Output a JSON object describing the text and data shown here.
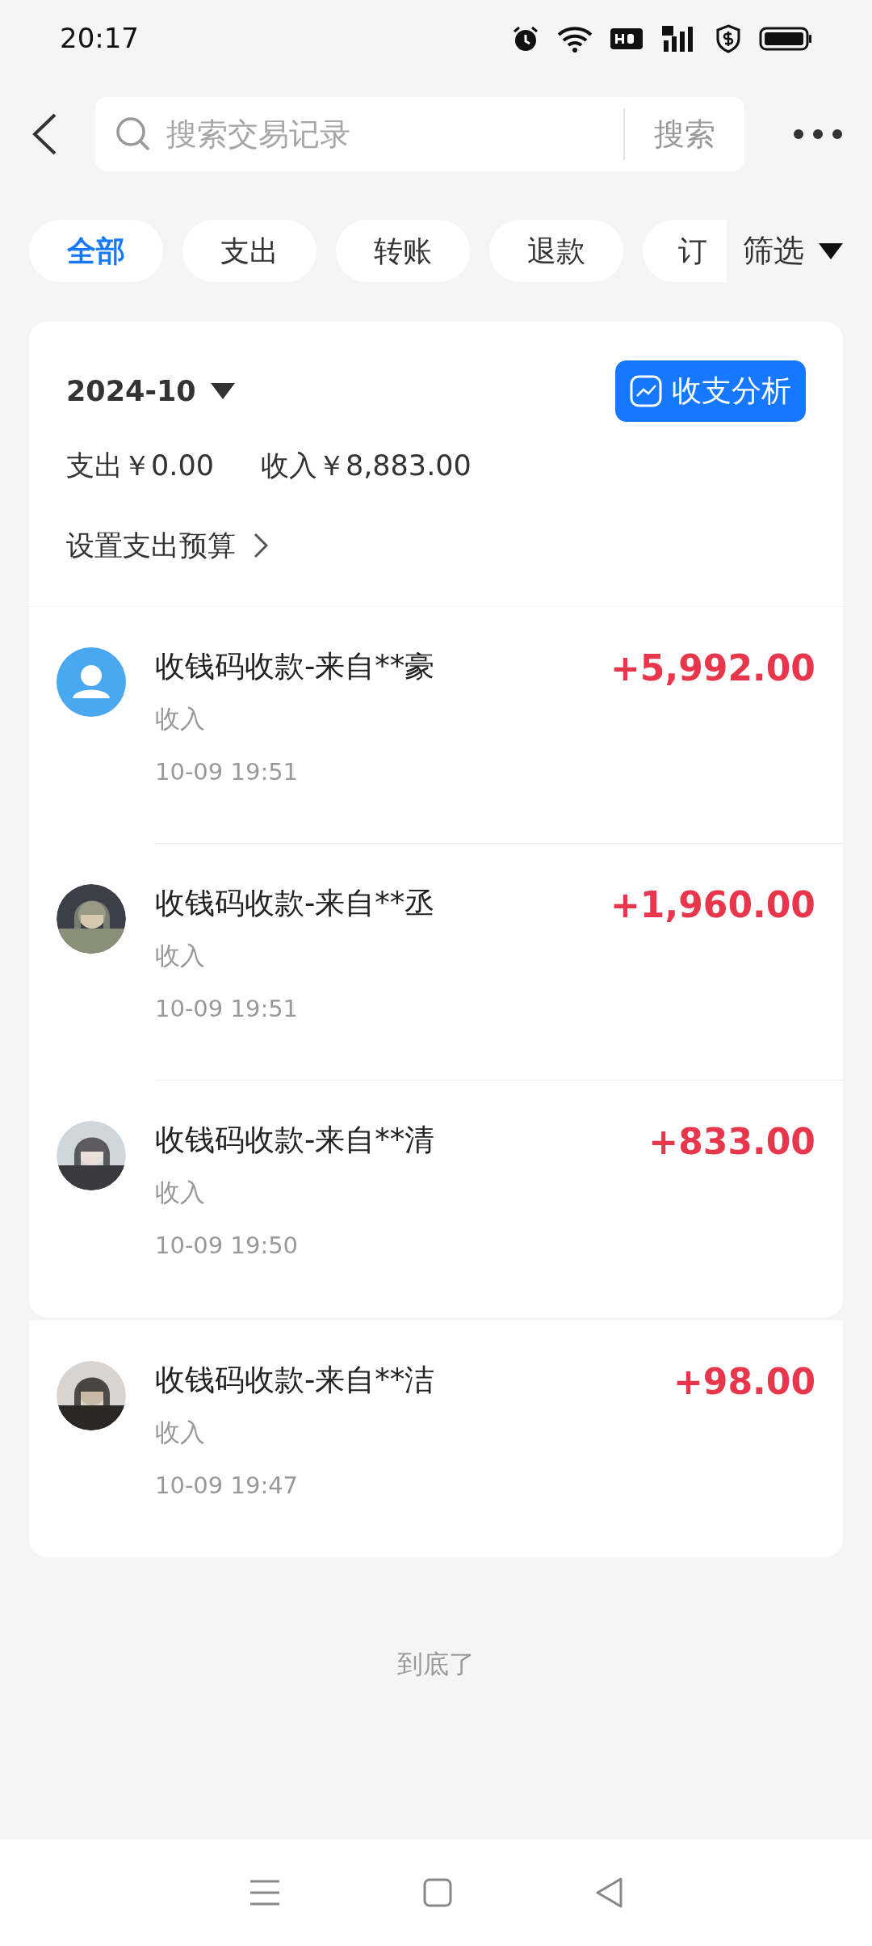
{
  "status_bar": {
    "time": "20:17"
  },
  "search": {
    "placeholder": "搜索交易记录",
    "button": "搜索"
  },
  "tabs": [
    {
      "label": "全部",
      "selected": true
    },
    {
      "label": "支出",
      "selected": false
    },
    {
      "label": "转账",
      "selected": false
    },
    {
      "label": "退款",
      "selected": false
    },
    {
      "label": "订",
      "selected": false
    }
  ],
  "filter": {
    "label": "筛选"
  },
  "summary": {
    "month": "2024-10",
    "analysis_button": "收支分析",
    "expense": "支出￥0.00",
    "income": "收入￥8,883.00",
    "budget_link": "设置支出预算"
  },
  "transactions": [
    {
      "avatar": {
        "kind": "default"
      },
      "title": "收钱码收款-来自**豪",
      "type": "收入",
      "time": "10-09 19:51",
      "amount": "+5,992.00"
    },
    {
      "title": "收钱码收款-来自**丞",
      "type": "收入",
      "time": "10-09 19:51",
      "amount": "+1,960.00"
    },
    {
      "title": "收钱码收款-来自**清",
      "type": "收入",
      "time": "10-09 19:50",
      "amount": "+833.00"
    },
    {
      "title": "收钱码收款-来自**洁",
      "type": "收入",
      "time": "10-09 19:47",
      "amount": "+98.00"
    }
  ],
  "footer": "到底了"
}
